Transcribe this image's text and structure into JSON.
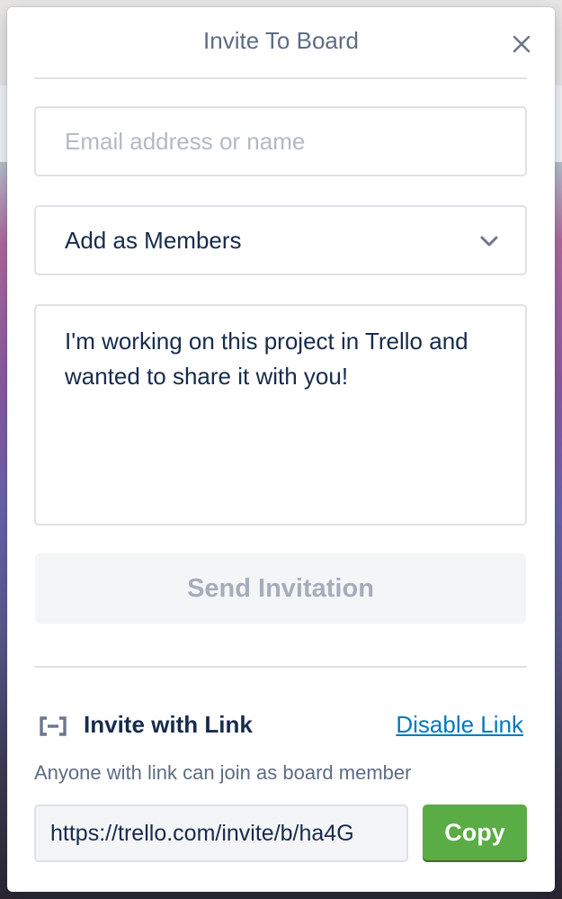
{
  "popover": {
    "title": "Invite To Board",
    "close_icon": "close-icon"
  },
  "invite_form": {
    "email_placeholder": "Email address or name",
    "email_value": "",
    "role_select_value": "Add as Members",
    "message_value": "I'm working on this project in Trello and wanted to share it with you!",
    "send_button_label": "Send Invitation"
  },
  "invite_link": {
    "icon": "link-icon",
    "title": "Invite with Link",
    "disable_label": "Disable Link",
    "description": "Anyone with link can join as board member",
    "url": "https://trello.com/invite/b/ha4G",
    "copy_label": "Copy"
  },
  "colors": {
    "primary_text": "#172b4d",
    "muted_text": "#5e6c84",
    "link": "#0079bf",
    "copy_button": "#5aac44",
    "disabled_button_bg": "#f4f5f7",
    "disabled_button_text": "#a5adba",
    "border": "#dfe1e6"
  }
}
